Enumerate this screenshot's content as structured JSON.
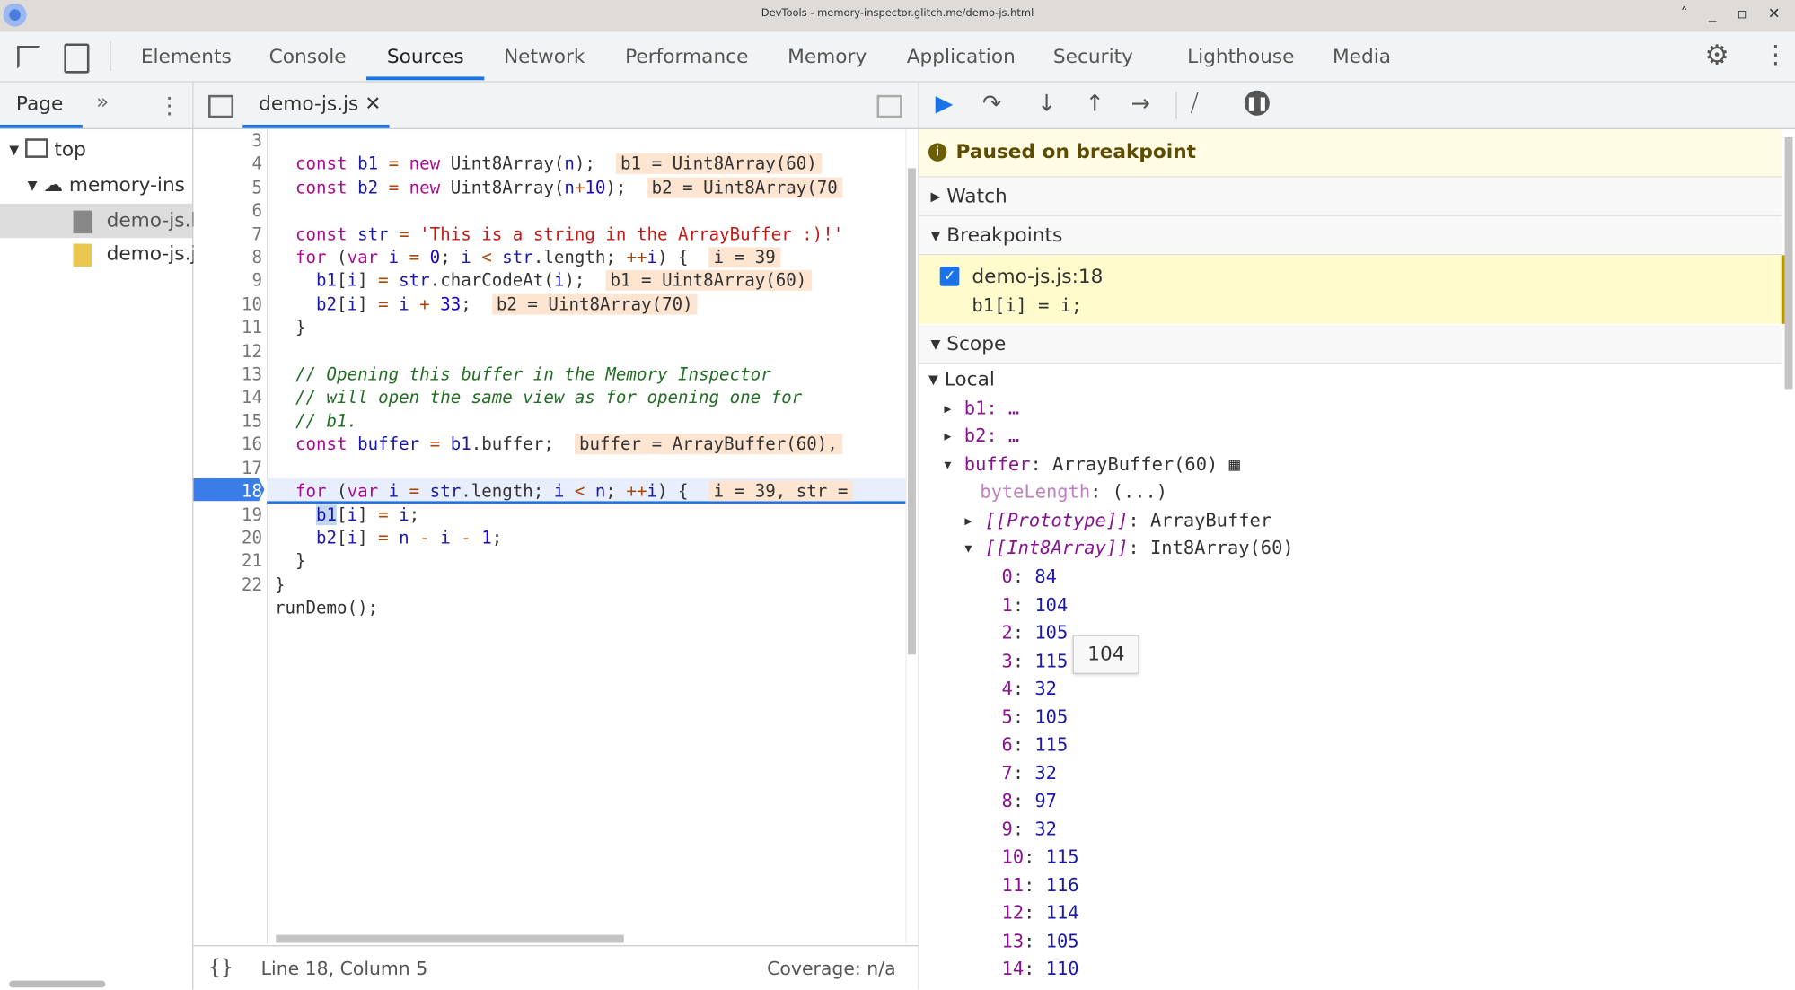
{
  "window": {
    "title": "DevTools - memory-inspector.glitch.me/demo-js.html"
  },
  "tabs": [
    "Elements",
    "Console",
    "Sources",
    "Network",
    "Performance",
    "Memory",
    "Application",
    "Security",
    "Lighthouse",
    "Media"
  ],
  "active_tab": "Sources",
  "navigator": {
    "tab": "Page",
    "tree": [
      "top",
      "memory-ins",
      "demo-js.h",
      "demo-js.j"
    ]
  },
  "editor": {
    "file_tab": "demo-js.js",
    "status": "Line 18, Column 5",
    "coverage": "Coverage: n/a",
    "current_line": 18
  },
  "debugger": {
    "paused": "Paused on breakpoint",
    "watch": "Watch",
    "breakpoints_label": "Breakpoints",
    "breakpoint": {
      "file": "demo-js.js:18",
      "code": "b1[i] = i;",
      "checked": true
    },
    "scope": "Scope",
    "local": "Local",
    "vars": [
      "b1: …",
      "b2: …"
    ],
    "buffer": {
      "name": "buffer",
      "value": "ArrayBuffer(60)",
      "byteLength": "byteLength",
      "byteLength_value": "(...)",
      "proto": "[[Prototype]]",
      "proto_value": "ArrayBuffer",
      "int8": "[[Int8Array]]",
      "int8_value": "Int8Array(60)"
    },
    "entries": [
      [
        "0",
        "84"
      ],
      [
        "1",
        "104"
      ],
      [
        "2",
        "105"
      ],
      [
        "3",
        "115"
      ],
      [
        "4",
        "32"
      ],
      [
        "5",
        "105"
      ],
      [
        "6",
        "115"
      ],
      [
        "7",
        "32"
      ],
      [
        "8",
        "97"
      ],
      [
        "9",
        "32"
      ],
      [
        "10",
        "115"
      ],
      [
        "11",
        "116"
      ],
      [
        "12",
        "114"
      ],
      [
        "13",
        "105"
      ],
      [
        "14",
        "110"
      ]
    ],
    "tooltip": "104"
  }
}
